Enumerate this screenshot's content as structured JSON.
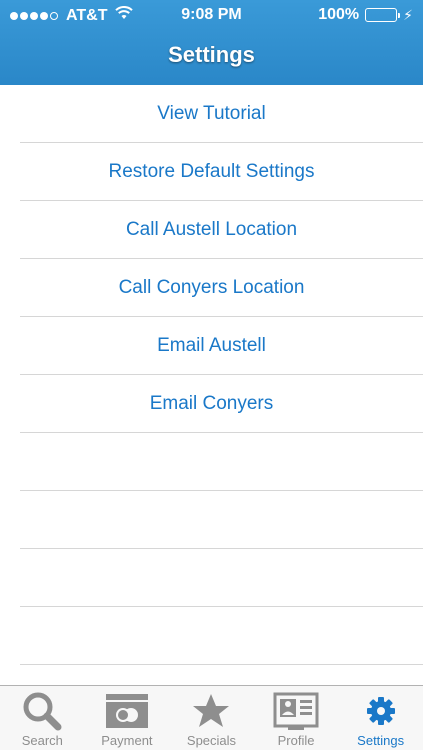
{
  "status_bar": {
    "carrier": "AT&T",
    "time": "9:08 PM",
    "battery": "100%",
    "signal_bars": 4
  },
  "header": {
    "title": "Settings"
  },
  "settings": {
    "items": [
      {
        "label": "View Tutorial"
      },
      {
        "label": "Restore Default Settings"
      },
      {
        "label": "Call Austell Location"
      },
      {
        "label": "Call Conyers Location"
      },
      {
        "label": "Email Austell"
      },
      {
        "label": "Email Conyers"
      }
    ]
  },
  "tabbar": {
    "tabs": [
      {
        "label": "Search",
        "icon": "search-icon",
        "active": false
      },
      {
        "label": "Payment",
        "icon": "payment-icon",
        "active": false
      },
      {
        "label": "Specials",
        "icon": "star-icon",
        "active": false
      },
      {
        "label": "Profile",
        "icon": "profile-card-icon",
        "active": false
      },
      {
        "label": "Settings",
        "icon": "gear-icon",
        "active": true
      }
    ]
  },
  "colors": {
    "header_blue": "#2a87c8",
    "link_blue": "#1a78c8",
    "inactive_gray": "#8e8e8e",
    "battery_green": "#4cd964"
  }
}
